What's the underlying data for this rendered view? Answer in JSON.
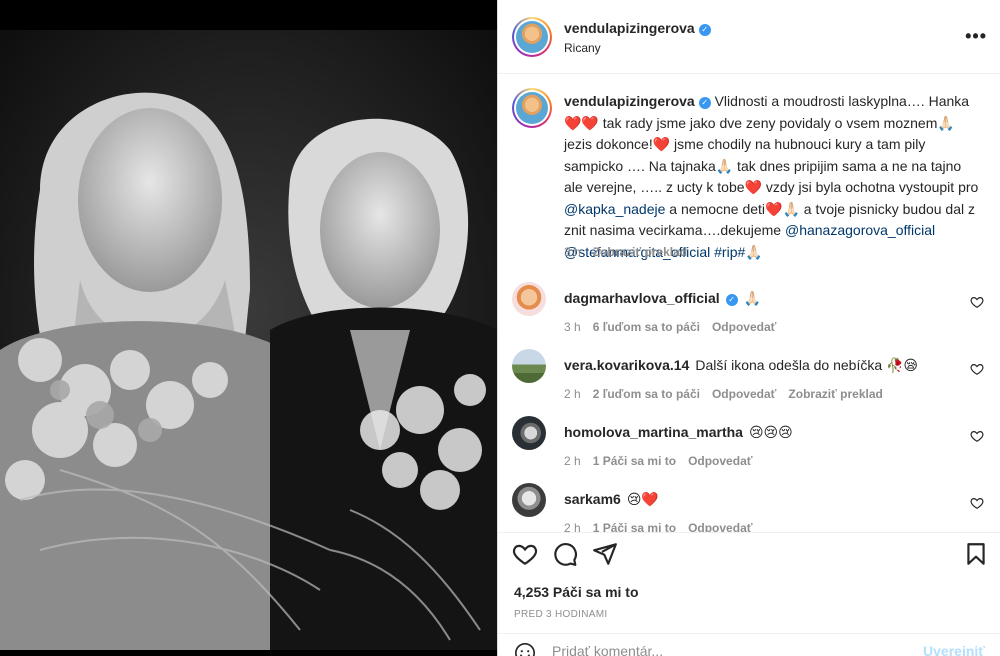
{
  "post": {
    "username": "vendulapizingerova",
    "location": "Ricany",
    "more_icon": "more-horizontal-icon"
  },
  "caption": {
    "username": "vendulapizingerova",
    "parts": [
      "Vlidnosti a moudrosti laskyplna…. Hanka ",
      "❤️❤️",
      " tak rady jsme jako dve zeny povidaly o vsem moznem",
      "🙏🏻",
      " jezis dokonce!",
      "❤️",
      " jsme chodily na hubnouci kury a tam pily sampicko …. Na tajnaka",
      "🙏🏻",
      " tak dnes pripijim sama a ne na tajno ale verejne, ….. z ucty k tobe",
      "❤️",
      " vzdy jsi byla ochotna vystoupit pro ",
      "@kapka_nadeje",
      " a nemocne deti",
      "❤️🙏🏻",
      " a tvoje pisnicky budou dal z znit nasima vecirkama….dekujeme ",
      "@hanazagorova_official",
      " ",
      "@stefanmargita_official",
      " #rip#",
      "🙏🏻"
    ],
    "time": "3 h",
    "translate": "Zobraziť preklad"
  },
  "comments": [
    {
      "username": "dagmarhavlova_official",
      "verified": true,
      "text": "🙏🏻",
      "time": "3 h",
      "likes": "6 ľuďom sa to páči",
      "reply": "Odpovedať",
      "translate": ""
    },
    {
      "username": "vera.kovarikova.14",
      "verified": false,
      "text": "Další ikona odešla do nebíčka 🥀😪",
      "time": "2 h",
      "likes": "2 ľuďom sa to páči",
      "reply": "Odpovedať",
      "translate": "Zobraziť preklad"
    },
    {
      "username": "homolova_martina_martha",
      "verified": false,
      "text": "😢😢😢",
      "time": "2 h",
      "likes": "1 Páči sa mi to",
      "reply": "Odpovedať",
      "translate": ""
    },
    {
      "username": "sarkam6",
      "verified": false,
      "text": "😢❤️",
      "time": "2 h",
      "likes": "1 Páči sa mi to",
      "reply": "Odpovedať",
      "translate": ""
    }
  ],
  "actions": {
    "like_icon": "heart-icon",
    "comment_icon": "comment-icon",
    "share_icon": "paper-plane-icon",
    "save_icon": "bookmark-icon",
    "likes": "4,253 Páči sa mi to",
    "ago": "PRED 3 HODINAMI"
  },
  "composer": {
    "placeholder": "Pridať komentár...",
    "post_label": "Uverejniť",
    "emoji_icon": "smiley-icon"
  },
  "colors": {
    "link": "#00376b",
    "verified": "#3897f0",
    "muted": "#8e8e8e",
    "post_disabled": "#b2dffc"
  }
}
